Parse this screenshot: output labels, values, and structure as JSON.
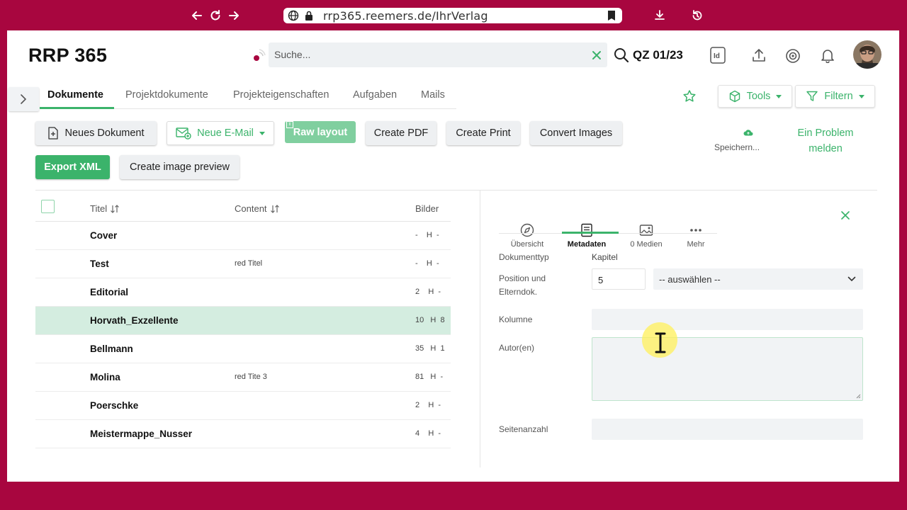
{
  "browser": {
    "url": "rrp365.reemers.de/IhrVerlag"
  },
  "header": {
    "brand": "RRP 365",
    "search_placeholder": "Suche...",
    "issue": "QZ 01/23"
  },
  "tabs": [
    {
      "label": "Dokumente",
      "active": true
    },
    {
      "label": "Projektdokumente",
      "active": false
    },
    {
      "label": "Projekteigenschaften",
      "active": false
    },
    {
      "label": "Aufgaben",
      "active": false
    },
    {
      "label": "Mails",
      "active": false
    }
  ],
  "toolbar": {
    "tools_label": "Tools",
    "filter_label": "Filtern",
    "new_document": "Neues Dokument",
    "new_email": "Neue E-Mail",
    "raw_layout": "Raw layout",
    "create_pdf": "Create PDF",
    "create_print": "Create Print",
    "convert_images": "Convert Images",
    "export_xml": "Export XML",
    "create_preview": "Create image preview",
    "save_status": "Speichern...",
    "problem_line1": "Ein Problem",
    "problem_line2": "melden"
  },
  "table": {
    "headers": {
      "title": "Titel",
      "content": "Content",
      "images": "Bilder"
    },
    "rows": [
      {
        "title": "Cover",
        "content": "",
        "images": "-    H  -",
        "selected": false
      },
      {
        "title": "Test",
        "content": "red Titel",
        "images": "-    H  -",
        "selected": false
      },
      {
        "title": "Editorial",
        "content": "",
        "images": "2    H  -",
        "selected": false
      },
      {
        "title": "Horvath_Exzellente",
        "content": "",
        "images": "10   H  8",
        "selected": true
      },
      {
        "title": "Bellmann",
        "content": "",
        "images": "35   H  1",
        "selected": false
      },
      {
        "title": "Molina",
        "content": "red Tite 3",
        "images": "81   H  -",
        "selected": false
      },
      {
        "title": "Poerschke",
        "content": "",
        "images": "2    H  -",
        "selected": false
      },
      {
        "title": "Meistermappe_Nusser",
        "content": "",
        "images": "4    H  -",
        "selected": false
      }
    ]
  },
  "detail": {
    "tabs": {
      "overview": "Übersicht",
      "metadata": "Metadaten",
      "media": "0 Medien",
      "more": "Mehr"
    },
    "doc_type_label": "Dokumenttyp",
    "doc_type_value": "Kapitel",
    "position_label_1": "Position und",
    "position_label_2": "Elterndok.",
    "position_value": "5",
    "parent_select": "-- auswählen --",
    "column_label": "Kolumne",
    "author_label": "Autor(en)",
    "pages_label": "Seitenanzahl"
  },
  "colors": {
    "accent": "#3bb36b",
    "frame": "#a8063f",
    "selected_row": "#d4ede0"
  }
}
